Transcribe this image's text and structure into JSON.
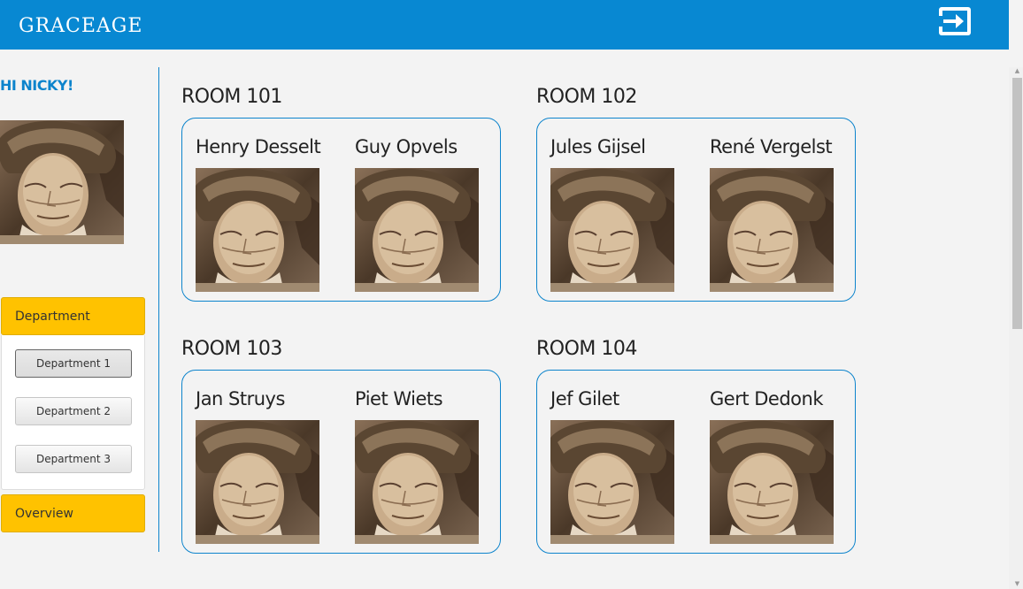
{
  "header": {
    "brand": "GRACEAGE",
    "logout_icon": "logout-icon"
  },
  "sidebar": {
    "greeting": "HI NICKY!",
    "avatar_icon": "elderly-portrait",
    "department_panel": {
      "title": "Department",
      "buttons": [
        "Department 1",
        "Department 2",
        "Department 3"
      ],
      "active_index": 0
    },
    "overview_label": "Overview"
  },
  "rooms": [
    {
      "title": "ROOM 101",
      "residents": [
        "Henry Desselt",
        "Guy Opvels"
      ]
    },
    {
      "title": "ROOM 102",
      "residents": [
        "Jules Gijsel",
        "René Vergelst"
      ]
    },
    {
      "title": "ROOM 103",
      "residents": [
        "Jan Struys",
        "Piet Wiets"
      ]
    },
    {
      "title": "ROOM 104",
      "residents": [
        "Jef Gilet",
        "Gert Dedonk"
      ]
    }
  ],
  "colors": {
    "header_blue": "#0888d2",
    "accent_blue": "#0d84cc",
    "panel_yellow": "#ffc200",
    "background": "#f3f3f3"
  }
}
